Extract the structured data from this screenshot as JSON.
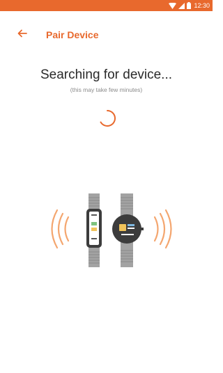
{
  "status_bar": {
    "time": "12:30",
    "icons": [
      "wifi-icon",
      "signal-icon",
      "battery-icon"
    ]
  },
  "app_bar": {
    "title": "Pair Device",
    "back_icon": "arrow-left-icon"
  },
  "content": {
    "heading": "Searching for device...",
    "subheading": "(this may take few minutes)"
  },
  "colors": {
    "accent": "#e8692d",
    "wave": "#f4a66f",
    "band": "#9a9a9a",
    "device_dark": "#3c3c3c"
  },
  "spinner": {
    "state": "loading"
  }
}
